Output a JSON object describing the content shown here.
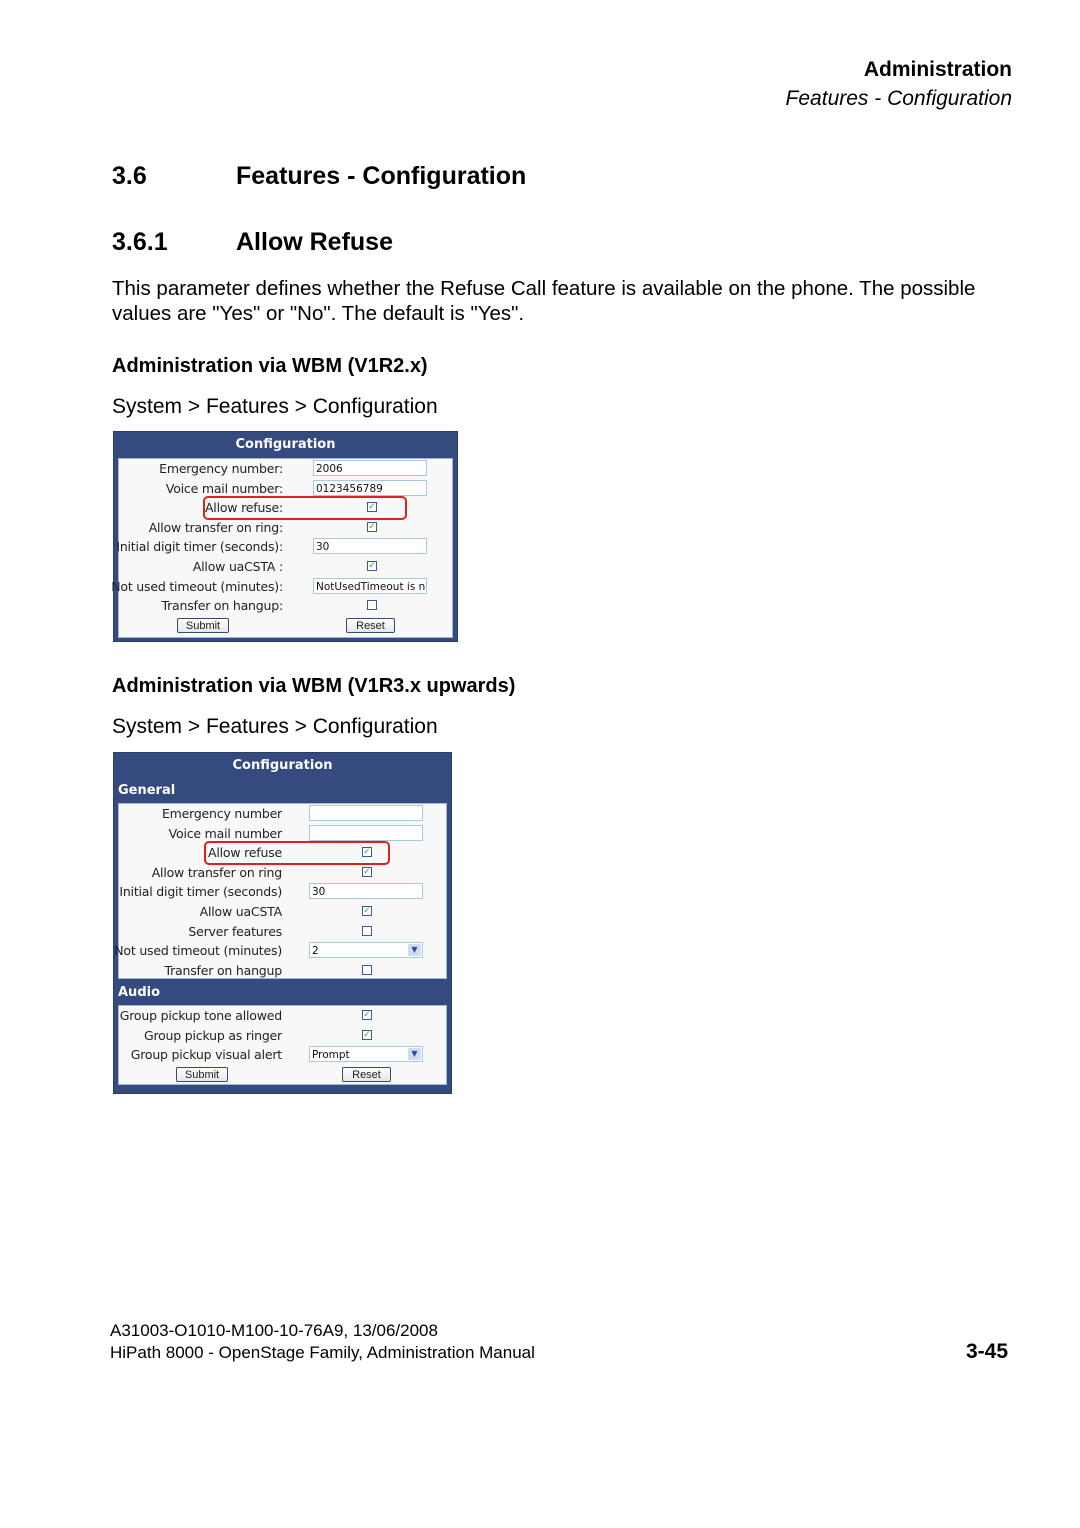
{
  "header": {
    "title": "Administration",
    "subtitle": "Features - Configuration"
  },
  "section": {
    "number": "3.6",
    "title": "Features - Configuration"
  },
  "subsection": {
    "number": "3.6.1",
    "title": "Allow Refuse"
  },
  "description": "This parameter defines whether the Refuse Call feature is available on the phone. The possible values are \"Yes\" or \"No\". The default is \"Yes\".",
  "v1r2": {
    "heading": "Administration via WBM (V1R2.x)",
    "path": "System > Features > Configuration",
    "panel": {
      "title": "Configuration",
      "rows": [
        {
          "label": "Emergency number:",
          "type": "text",
          "value": "2006"
        },
        {
          "label": "Voice mail number:",
          "type": "text",
          "value": "0123456789"
        },
        {
          "label": "Allow refuse:",
          "type": "checkbox",
          "checked": true,
          "highlighted": true
        },
        {
          "label": "Allow transfer on ring:",
          "type": "checkbox",
          "checked": true
        },
        {
          "label": "Initial digit timer (seconds):",
          "type": "text",
          "value": "30"
        },
        {
          "label": "Allow uaCSTA :",
          "type": "checkbox",
          "checked": true
        },
        {
          "label": "Not used timeout (minutes):",
          "type": "text",
          "value": "NotUsedTimeout is nc"
        },
        {
          "label": "Transfer on hangup:",
          "type": "checkbox",
          "checked": false
        }
      ],
      "submit_label": "Submit",
      "reset_label": "Reset"
    }
  },
  "v1r3": {
    "heading": "Administration via WBM (V1R3.x upwards)",
    "path": "System > Features > Configuration",
    "panel": {
      "title": "Configuration",
      "general_title": "General",
      "general_rows": [
        {
          "label": "Emergency number",
          "type": "text",
          "value": ""
        },
        {
          "label": "Voice mail number",
          "type": "text",
          "value": ""
        },
        {
          "label": "Allow refuse",
          "type": "checkbox",
          "checked": true,
          "highlighted": true
        },
        {
          "label": "Allow transfer on ring",
          "type": "checkbox",
          "checked": true
        },
        {
          "label": "Initial digit timer (seconds)",
          "type": "text",
          "value": "30"
        },
        {
          "label": "Allow uaCSTA",
          "type": "checkbox",
          "checked": true
        },
        {
          "label": "Server features",
          "type": "checkbox",
          "checked": false
        },
        {
          "label": "Not used timeout (minutes)",
          "type": "select",
          "value": "2"
        },
        {
          "label": "Transfer on hangup",
          "type": "checkbox",
          "checked": false
        }
      ],
      "audio_title": "Audio",
      "audio_rows": [
        {
          "label": "Group pickup tone allowed",
          "type": "checkbox",
          "checked": true
        },
        {
          "label": "Group pickup as ringer",
          "type": "checkbox",
          "checked": true
        },
        {
          "label": "Group pickup visual alert",
          "type": "select",
          "value": "Prompt"
        }
      ],
      "submit_label": "Submit",
      "reset_label": "Reset"
    }
  },
  "footer": {
    "doc_id": "A31003-O1010-M100-10-76A9, 13/06/2008",
    "manual": "HiPath 8000 - OpenStage Family, Administration Manual",
    "page": "3-45"
  },
  "colors": {
    "panel_bg": "#354a7e",
    "highlight": "#e02020",
    "check": "#2db82d"
  }
}
